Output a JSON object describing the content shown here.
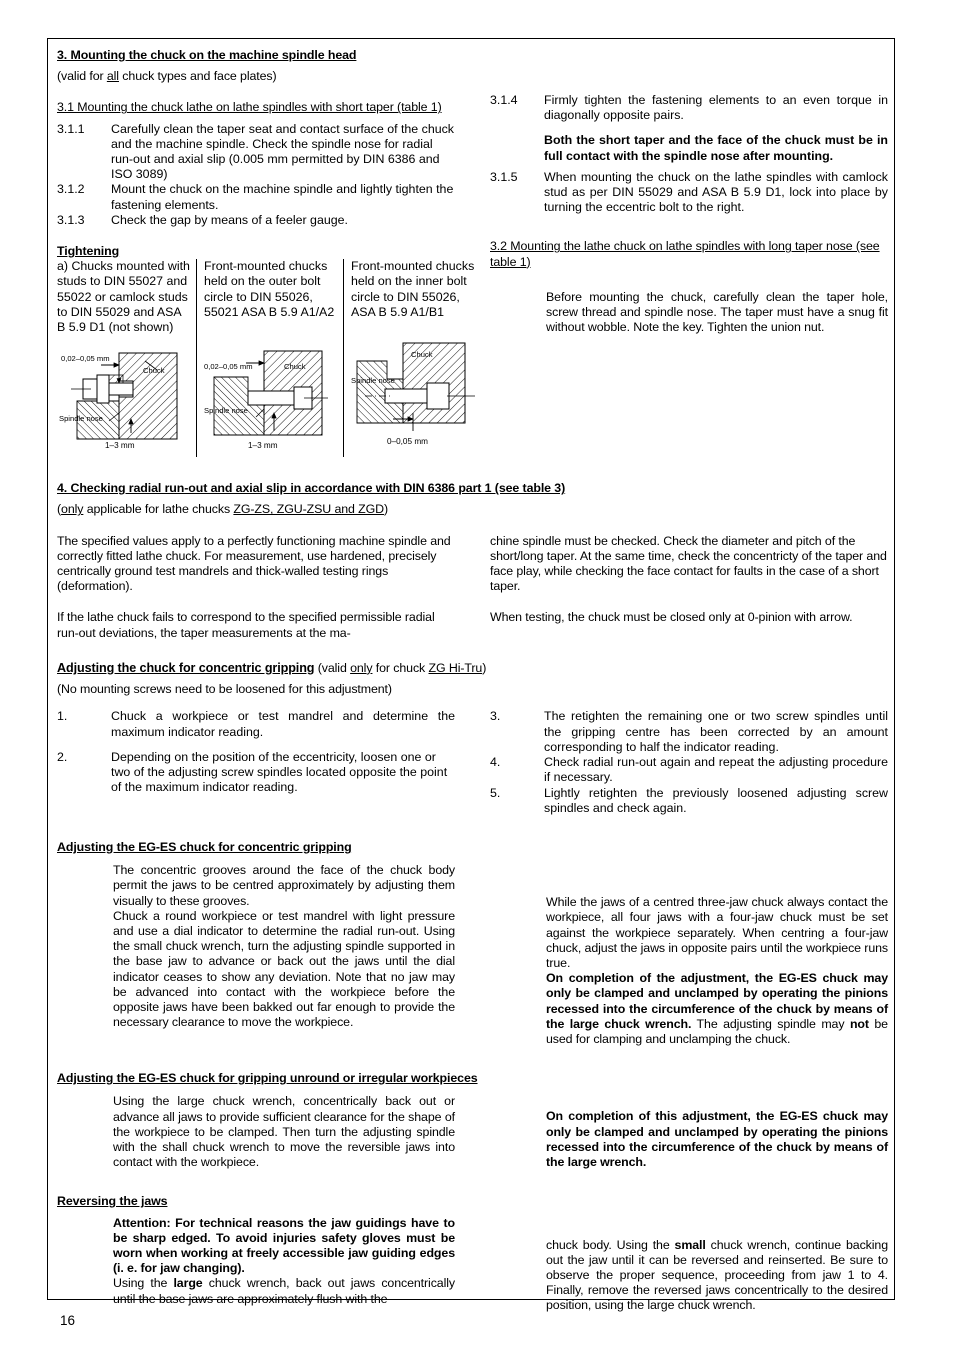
{
  "page": {
    "number": "16"
  },
  "section3": {
    "heading": "3. Mounting the chuck on the machine spindle head",
    "subnote_pre": "(valid for ",
    "subnote_ul": "all",
    "subnote_post": " chuck types and face plates)",
    "sub31": "3.1 Mounting the chuck lathe on lathe spindles with short taper (table 1)",
    "items": [
      {
        "num": "3.1.1",
        "text": "Carefully clean the taper seat and contact surface of the chuck and the machine spindle. Check the spindle nose for radial run-out and axial slip (0.005 mm permitted by DIN 6386 and ISO 3089)"
      },
      {
        "num": "3.1.2",
        "text": "Mount the chuck on the machine spindle and lightly tighten the fastening elements."
      },
      {
        "num": "3.1.3",
        "text": "Check the gap by means of a feeler gauge."
      },
      {
        "num": "3.1.4",
        "text": "Firmly tighten the fastening elements to an even torque in diagonally opposite pairs."
      },
      {
        "num": "3.1.5",
        "text": "When mounting the chuck on the lathe spindles with camlock stud as per DIN 55029 and ASA B 5.9 D1, lock into place by turning the eccentric bolt to the right."
      }
    ],
    "item314_bold_note": "Both the short taper and the face of the chuck must be in full contact with the spindle nose after mounting.",
    "sub32": "3.2 Mounting the lathe chuck on lathe spindles with long taper nose (see table 1)",
    "sub32_body": "Before mounting the chuck, carefully clean the taper hole, screw thread and spindle nose. The taper must have a snug fit without wobble. Note the key. Tighten the union nut."
  },
  "tightening": {
    "heading": "Tightening",
    "col1": "a) Chucks mounted with studs to DIN 55027 and 55022 or camlock studs to DIN 55029 and ASA B 5.9 D1 (not shown)",
    "col2": "Front-mounted chucks held on the outer bolt circle to DIN 55026, 55021 ASA B 5.9 A1/A2",
    "col3": "Front-mounted chucks held on the inner bolt circle to DIN 55026, ASA B 5.9 A1/B1",
    "diagram1": {
      "gap_label": "0,02–0,05 mm",
      "chuck_label": "Chuck",
      "spindle_label": "Spindle nose",
      "bottom_label": "1–3 mm"
    },
    "diagram2": {
      "gap_label": "0,02–0,05 mm",
      "chuck_label": "Chuck",
      "spindle_label": "Spindle nose",
      "bottom_label": "1–3 mm"
    },
    "diagram3": {
      "chuck_label": "Chuck",
      "spindle_label": "Spindle nose",
      "bottom_label": "0–0,05 mm"
    }
  },
  "section4": {
    "heading": "4. Checking radial run-out and axial slip in accordance with DIN 6386 part 1 (see table 3)",
    "sub_pre": "(",
    "sub_only": "only",
    "sub_mid": " applicable for lathe chucks ",
    "sub_ul": "ZG-ZS, ZGU-ZSU and ZGD",
    "sub_post": ")",
    "left_p1": "The specified values apply to a perfectly functioning machine spindle and correctly fitted lathe chuck. For measurement, use hardened, precisely centrically ground test mandrels and thick-walled testing rings (deformation).",
    "left_p2": "If the lathe chuck fails to correspond to the specified permissible radial run-out deviations, the taper measurements at the ma-",
    "right_p1": "chine spindle must be checked. Check the diameter and pitch of the short/long taper. At the same time, check the concentricty of the taper and face play, while checking the face contact for faults in the case of a short taper.",
    "right_p2": "When testing, the chuck must be closed only at 0-pinion with arrow."
  },
  "concentric": {
    "heading_bold": "Adjusting the chuck for concentric gripping",
    "heading_rest_pre": " (valid ",
    "heading_only": "only",
    "heading_mid": " for chuck ",
    "heading_ul": "ZG Hi-Tru",
    "heading_post": ")",
    "note": "(No mounting screws need to be loosened for this adjustment)",
    "items": [
      {
        "num": "1.",
        "text": "Chuck a workpiece or test mandrel and determine the maximum indicator reading."
      },
      {
        "num": "2.",
        "text": "Depending on the position of the eccentricity, loosen one or two of the adjusting screw spindles located opposite the point of the maximum indicator reading."
      },
      {
        "num": "3.",
        "text": "The retighten the remaining one or two screw spindles until the gripping centre has been corrected by an amount corresponding to half the indicator reading."
      },
      {
        "num": "4.",
        "text": "Check radial run-out again and repeat the adjusting procedure if necessary."
      },
      {
        "num": "5.",
        "text": "Lightly retighten the previously loosened adjusting screw spindles and check again."
      }
    ]
  },
  "eges_concentric": {
    "heading": "Adjusting the EG-ES chuck for concentric gripping",
    "left_p1": "The concentric grooves around the face of the chuck body permit the jaws to be centred approximately by adjusting them visually to these grooves.",
    "left_p2": "Chuck a round workpiece or test mandrel with light pressure and use a dial indicator to determine the radial run-out. Using the small chuck wrench, turn the adjusting spindle supported in the base jaw to advance or back out the jaws until the dial indicator ceases to show any deviation. Note that no jaw may be advanced into contact with the workpiece before the opposite jaws have been bakked out far enough to provide the necessary clearance to move the workpiece.",
    "right_p1": "While the jaws of a centred three-jaw chuck always contact the workpiece, all four jaws with a four-jaw chuck must be set against the workpiece separately. When centring a four-jaw chuck, adjust the jaws in opposite pairs until the workpiece runs true.",
    "right_p2_bold": "On completion of the adjustment, the EG-ES chuck may only be clamped and unclamped by operating the pinions recessed into the circumference of the chuck by means of the large chuck wrench.",
    "right_p2_tail_a": " The adjusting spindle may ",
    "right_p2_tail_bold": "not",
    "right_p2_tail_b": " be used for clamping and unclamping the chuck."
  },
  "eges_unround": {
    "heading": "Adjusting the EG-ES chuck for gripping unround or irregular workpieces",
    "left_p1": "Using the large chuck wrench, concentrically back out or advance all jaws to provide sufficient clearance for the shape of the workpiece to be clamped. Then turn the adjusting spindle with the shall chuck wrench to move the reversible jaws into contact with the workpiece.",
    "right_p1_bold": "On completion of this adjustment, the EG-ES chuck may only be clamped and unclamped by operating the pinions recessed into the circumference of the chuck by  means of the large wrench."
  },
  "reversing": {
    "heading": "Reversing the jaws",
    "left_bold": "Attention: For technical reasons the jaw guidings have to be sharp edged. To avoid injuries safety gloves must be worn when working at freely accessible jaw guiding edges (i. e. for jaw changing).",
    "left_tail_a": "Using the ",
    "left_tail_bold": "large",
    "left_tail_b": " chuck wrench, back out jaws concentrically until the base jaws are approximately flush with the",
    "right_a": "chuck body. Using the ",
    "right_bold": "small",
    "right_b": " chuck wrench, continue backing out the jaw until it can be reversed and reinserted. Be sure to observe the proper sequence, proceeding from jaw 1 to 4. Finally, remove the reversed jaws concentrically to the desired position, using the large chuck wrench."
  }
}
